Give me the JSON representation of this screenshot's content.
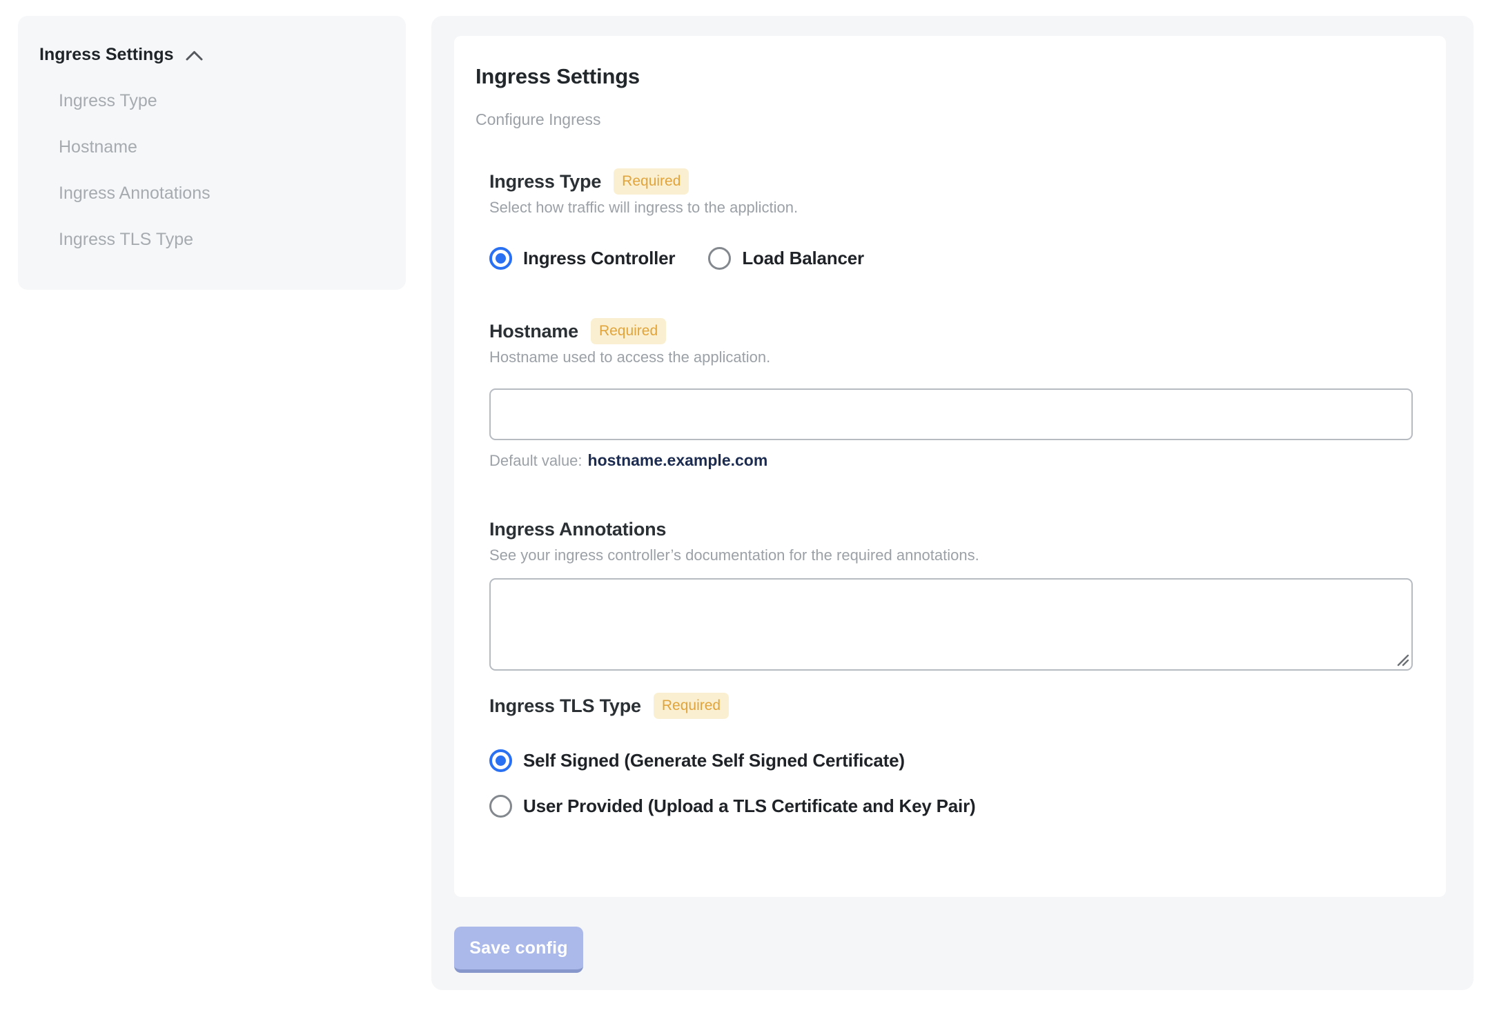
{
  "sidebar": {
    "title": "Ingress Settings",
    "items": [
      "Ingress Type",
      "Hostname",
      "Ingress Annotations",
      "Ingress TLS Type"
    ]
  },
  "form": {
    "title": "Ingress Settings",
    "subtitle": "Configure Ingress",
    "required_badge": "Required",
    "ingress_type": {
      "label": "Ingress Type",
      "description": "Select how traffic will ingress to the appliction.",
      "options": [
        {
          "label": "Ingress Controller",
          "selected": true
        },
        {
          "label": "Load Balancer",
          "selected": false
        }
      ]
    },
    "hostname": {
      "label": "Hostname",
      "description": "Hostname used to access the application.",
      "value": "",
      "default_prefix": "Default value:",
      "default_value": "hostname.example.com"
    },
    "annotations": {
      "label": "Ingress Annotations",
      "description": "See your ingress controller’s documentation for the required annotations.",
      "value": ""
    },
    "tls_type": {
      "label": "Ingress TLS Type",
      "options": [
        {
          "label": "Self Signed (Generate Self Signed Certificate)",
          "selected": true
        },
        {
          "label": "User Provided (Upload a TLS Certificate and Key Pair)",
          "selected": false
        }
      ]
    },
    "save_button": "Save config"
  },
  "icons": {
    "sidebar_collapse": "chevron-up",
    "textarea_corner": "resize-grip"
  },
  "colors": {
    "accent_blue": "#2970f3",
    "badge_bg": "#faf0d1",
    "badge_text": "#e1a43c",
    "default_value_text": "#1c2b50",
    "save_button_bg": "#aab8ea",
    "save_button_edge": "#8897cb",
    "panel_bg": "#f5f6f8"
  }
}
